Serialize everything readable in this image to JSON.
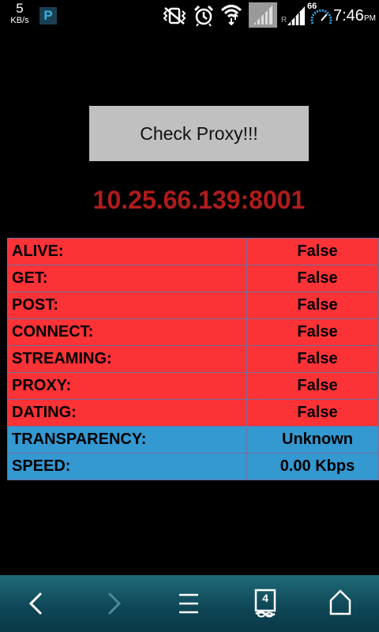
{
  "statusbar": {
    "net_speed_value": "5",
    "net_speed_unit": "KB/s",
    "p_badge": "P",
    "battery_level": "66",
    "network_type": "R",
    "time": "7:46",
    "ampm": "PM",
    "icons": [
      "p-notification-icon",
      "muted-vibrate-icon",
      "alarm-icon",
      "wifi-icon",
      "signal-disabled-icon",
      "signal-icon",
      "battery-icon"
    ]
  },
  "main": {
    "check_button_label": "Check Proxy!!!",
    "proxy_address": "10.25.66.139:8001",
    "address_color": "#b01c1c"
  },
  "results": {
    "rows": [
      {
        "label": "ALIVE:",
        "value": "False",
        "status": "red"
      },
      {
        "label": "GET:",
        "value": "False",
        "status": "red"
      },
      {
        "label": "POST:",
        "value": "False",
        "status": "red"
      },
      {
        "label": "CONNECT:",
        "value": "False",
        "status": "red"
      },
      {
        "label": "STREAMING:",
        "value": "False",
        "status": "red"
      },
      {
        "label": "PROXY:",
        "value": "False",
        "status": "red"
      },
      {
        "label": "DATING:",
        "value": "False",
        "status": "red"
      },
      {
        "label": "TRANSPARENCY:",
        "value": "Unknown",
        "status": "blue"
      },
      {
        "label": "SPEED:",
        "value": "0.00 Kbps",
        "status": "blue"
      }
    ],
    "colors": {
      "red": "#fb3236",
      "blue": "#3498d1"
    }
  },
  "navbar": {
    "tab_count": "4",
    "icons": [
      "back-icon",
      "forward-icon",
      "menu-icon",
      "tabs-icon",
      "home-icon"
    ]
  }
}
